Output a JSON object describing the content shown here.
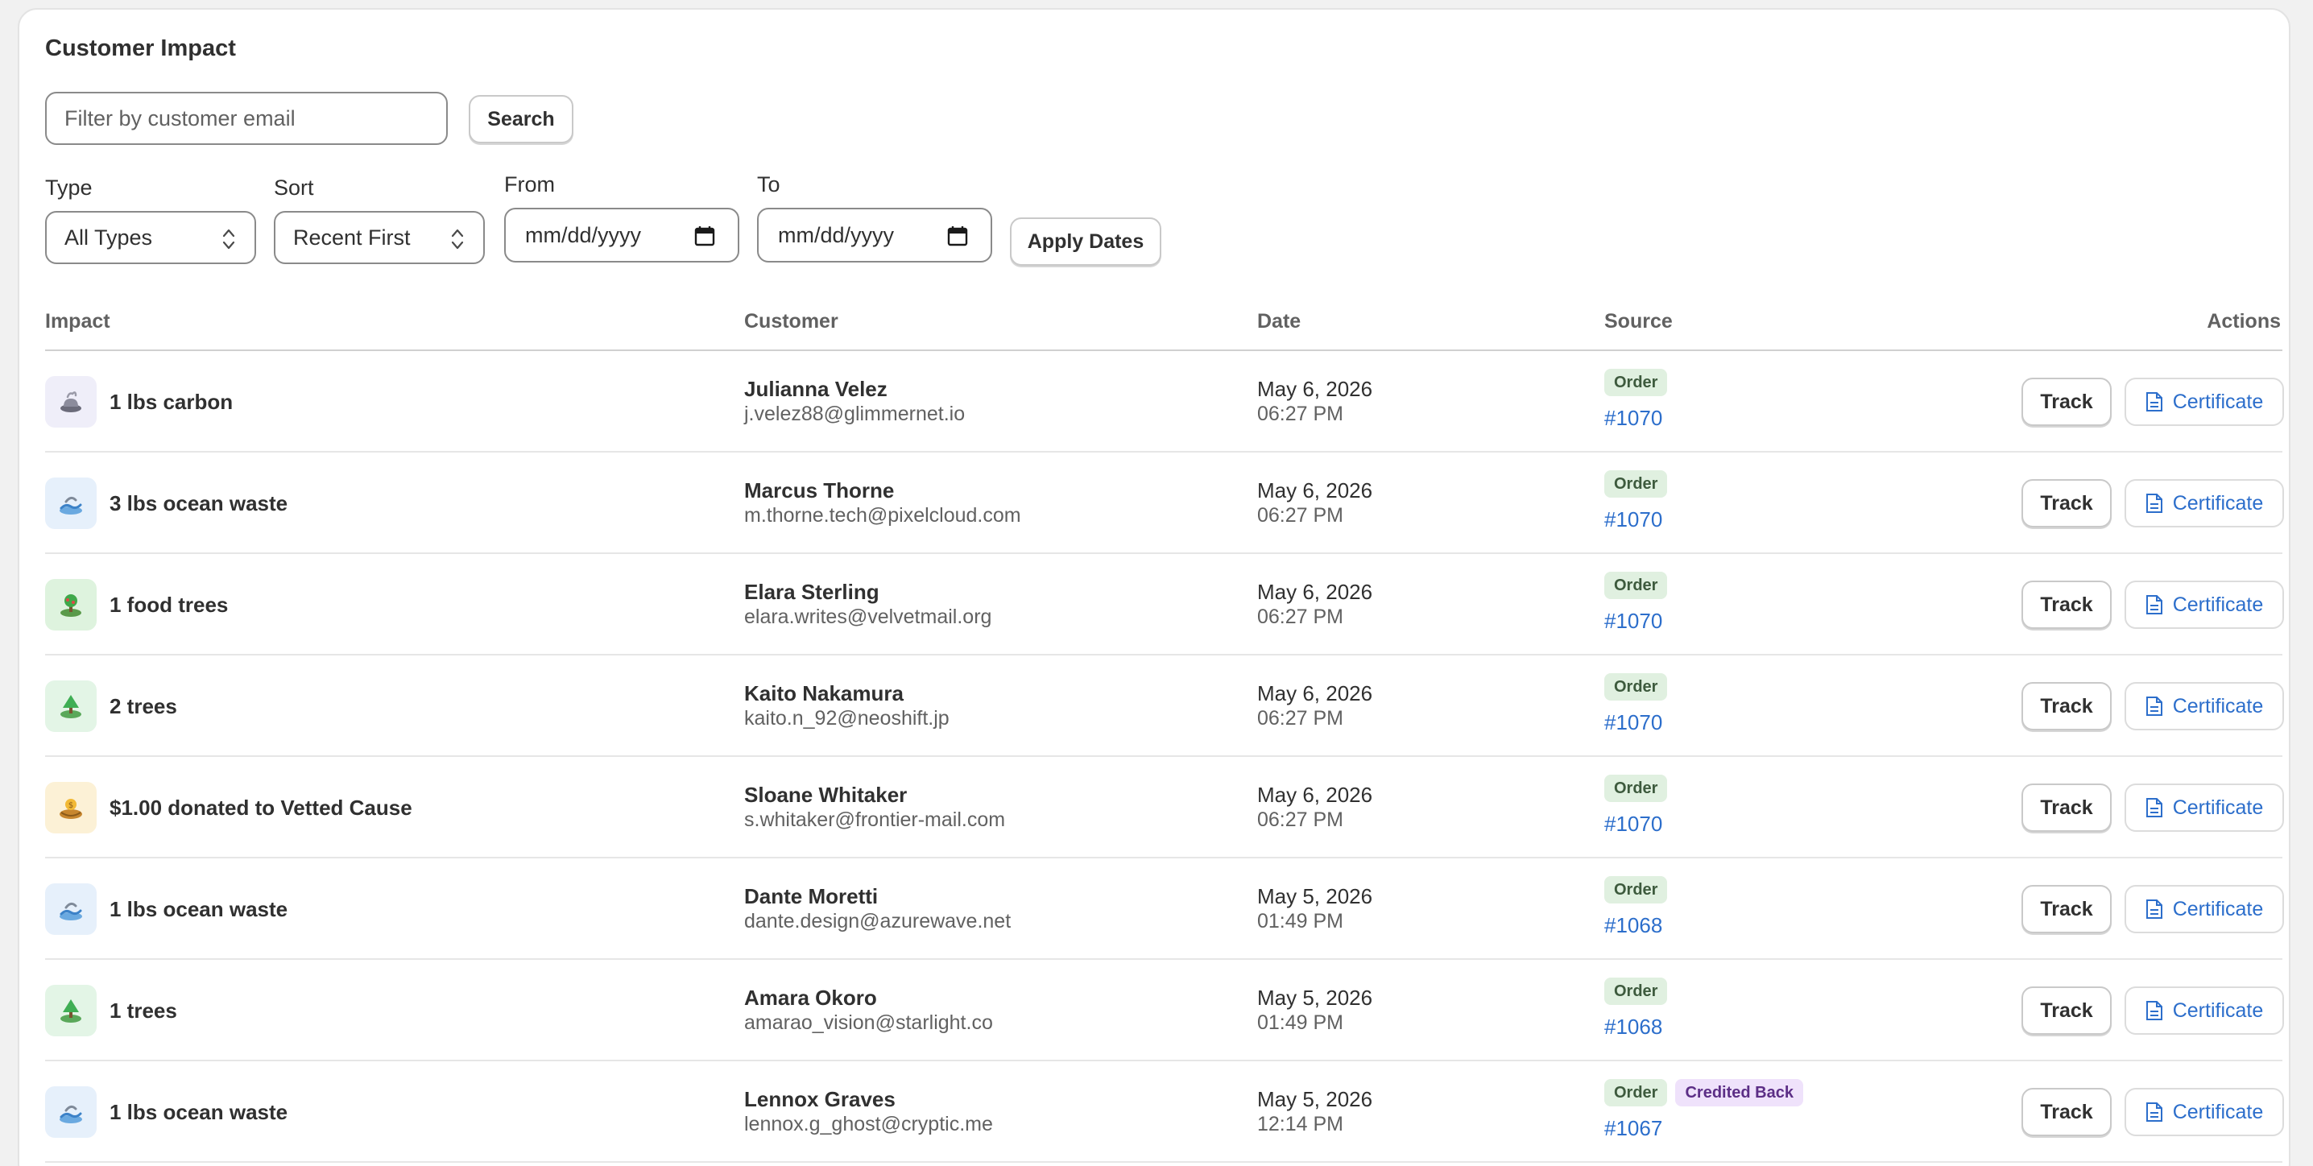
{
  "title": "Customer Impact",
  "search": {
    "placeholder": "Filter by customer email",
    "button_label": "Search"
  },
  "filters": {
    "type_label": "Type",
    "type_value": "All Types",
    "sort_label": "Sort",
    "sort_value": "Recent First",
    "from_label": "From",
    "from_placeholder": "mm/dd/yyyy",
    "to_label": "To",
    "to_placeholder": "mm/dd/yyyy",
    "apply_label": "Apply Dates"
  },
  "table": {
    "headers": {
      "impact": "Impact",
      "customer": "Customer",
      "date": "Date",
      "source": "Source",
      "actions": "Actions"
    },
    "track_label": "Track",
    "certificate_label": "Certificate",
    "rows": [
      {
        "impact": "1 lbs carbon",
        "icon": "carbon-icon",
        "icon_bg": "#efeef9",
        "name": "Julianna Velez",
        "email": "j.velez88@glimmernet.io",
        "date": "May 6, 2026",
        "time": "06:27 PM",
        "badges": [
          "Order"
        ],
        "source": "#1070"
      },
      {
        "impact": "3 lbs ocean waste",
        "icon": "ocean-waste-icon",
        "icon_bg": "#e6f0fb",
        "name": "Marcus Thorne",
        "email": "m.thorne.tech@pixelcloud.com",
        "date": "May 6, 2026",
        "time": "06:27 PM",
        "badges": [
          "Order"
        ],
        "source": "#1070"
      },
      {
        "impact": "1 food trees",
        "icon": "food-tree-icon",
        "icon_bg": "#def3de",
        "name": "Elara Sterling",
        "email": "elara.writes@velvetmail.org",
        "date": "May 6, 2026",
        "time": "06:27 PM",
        "badges": [
          "Order"
        ],
        "source": "#1070"
      },
      {
        "impact": "2 trees",
        "icon": "tree-icon",
        "icon_bg": "#e3f5e6",
        "name": "Kaito Nakamura",
        "email": "kaito.n_92@neoshift.jp",
        "date": "May 6, 2026",
        "time": "06:27 PM",
        "badges": [
          "Order"
        ],
        "source": "#1070"
      },
      {
        "impact": "$1.00 donated to Vetted Cause",
        "icon": "donation-icon",
        "icon_bg": "#fcf1d6",
        "name": "Sloane Whitaker",
        "email": "s.whitaker@frontier-mail.com",
        "date": "May 6, 2026",
        "time": "06:27 PM",
        "badges": [
          "Order"
        ],
        "source": "#1070"
      },
      {
        "impact": "1 lbs ocean waste",
        "icon": "ocean-waste-icon",
        "icon_bg": "#e6f0fb",
        "name": "Dante Moretti",
        "email": "dante.design@azurewave.net",
        "date": "May 5, 2026",
        "time": "01:49 PM",
        "badges": [
          "Order"
        ],
        "source": "#1068"
      },
      {
        "impact": "1 trees",
        "icon": "tree-icon",
        "icon_bg": "#e3f5e6",
        "name": "Amara Okoro",
        "email": "amarao_vision@starlight.co",
        "date": "May 5, 2026",
        "time": "01:49 PM",
        "badges": [
          "Order"
        ],
        "source": "#1068"
      },
      {
        "impact": "1 lbs ocean waste",
        "icon": "ocean-waste-icon",
        "icon_bg": "#e6f0fb",
        "name": "Lennox Graves",
        "email": "lennox.g_ghost@cryptic.me",
        "date": "May 5, 2026",
        "time": "12:14 PM",
        "badges": [
          "Order",
          "Credited Back"
        ],
        "source": "#1067"
      }
    ]
  }
}
